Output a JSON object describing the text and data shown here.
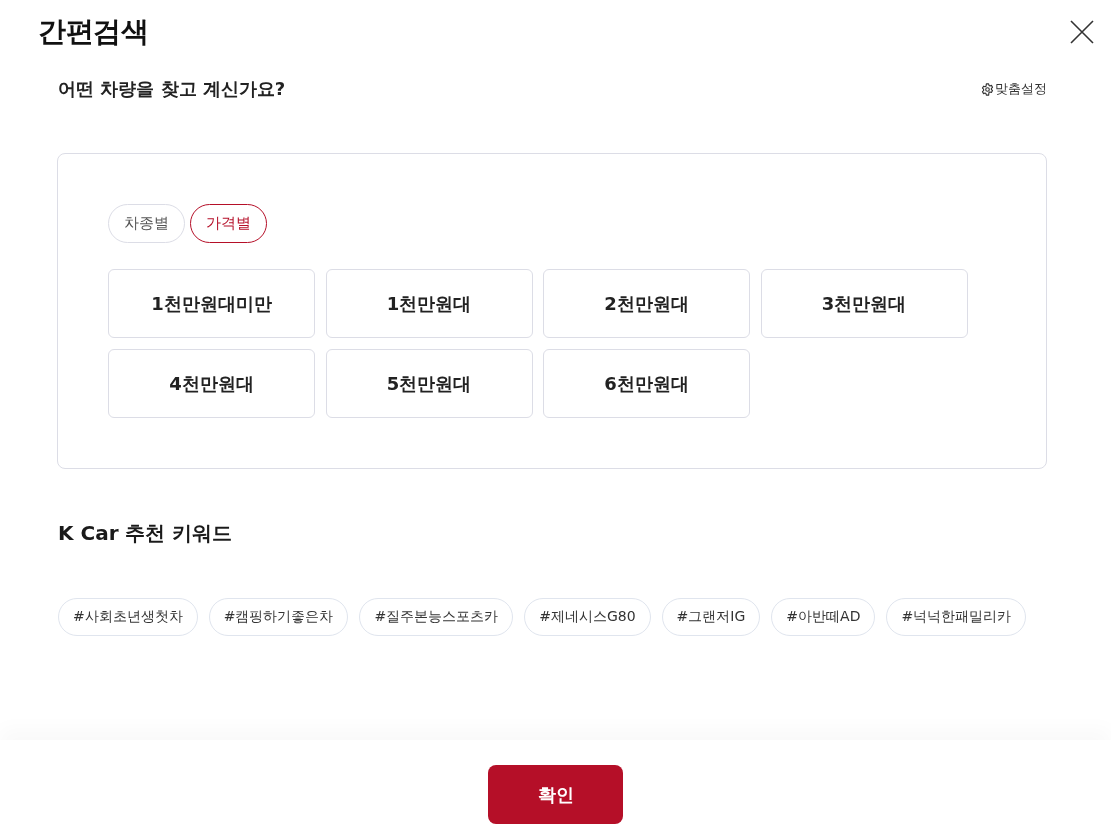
{
  "dialog": {
    "title": "간편검색"
  },
  "question": {
    "text": "어떤 차량을 찾고 계신가요?",
    "settings_link": "맞춤설정"
  },
  "filter_tabs": [
    {
      "label": "차종별",
      "selected": false
    },
    {
      "label": "가격별",
      "selected": true
    }
  ],
  "price_options": [
    {
      "label": "1천만원대미만",
      "selected": false
    },
    {
      "label": "1천만원대",
      "selected": false
    },
    {
      "label": "2천만원대",
      "selected": false
    },
    {
      "label": "3천만원대",
      "selected": false
    },
    {
      "label": "4천만원대",
      "selected": false
    },
    {
      "label": "5천만원대",
      "selected": false
    },
    {
      "label": "6천만원대",
      "selected": false
    }
  ],
  "keywords_section": {
    "title": "K Car 추천 키워드",
    "keywords": [
      "#사회초년생첫차",
      "#캠핑하기좋은차",
      "#질주본능스포츠카",
      "#제네시스G80",
      "#그랜저IG",
      "#아반떼AD",
      "#넉넉한패밀리카"
    ]
  },
  "footer": {
    "confirm_button": "확인"
  }
}
